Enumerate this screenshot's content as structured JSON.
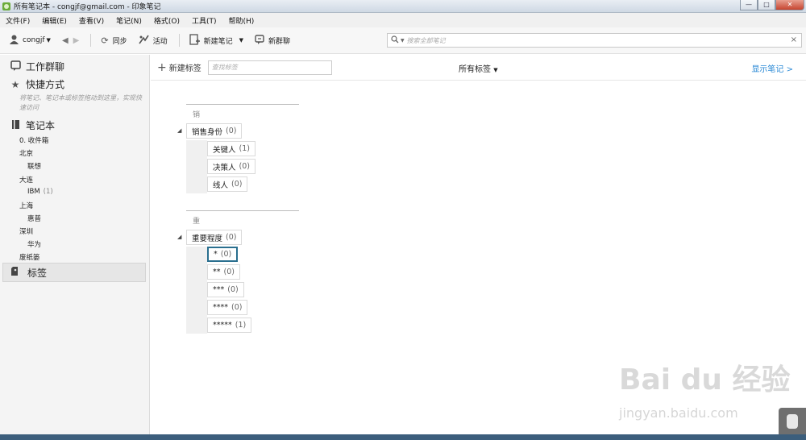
{
  "window": {
    "title": "所有笔记本 - congjf@gmail.com - 印象笔记",
    "minimize": "—",
    "maximize": "□",
    "close": "✕"
  },
  "menu": [
    "文件(F)",
    "编辑(E)",
    "查看(V)",
    "笔记(N)",
    "格式(O)",
    "工具(T)",
    "帮助(H)"
  ],
  "toolbar": {
    "user": "congjf",
    "sync": "同步",
    "activity": "活动",
    "new_note": "新建笔记",
    "new_chat": "新群聊",
    "search_placeholder": "搜索全部笔记",
    "icons": [
      "user-icon",
      "back-arrow-icon",
      "forward-arrow-icon",
      "sync-icon",
      "activity-icon",
      "new-note-icon",
      "chat-icon",
      "search-icon",
      "clear-icon"
    ]
  },
  "sidebar": {
    "work_chat": "工作群聊",
    "shortcuts": "快捷方式",
    "shortcuts_hint": "将笔记、笔记本或标签拖动到这里，实现快速访问",
    "notebooks": "笔记本",
    "notebook_items": [
      {
        "label": "0. 收件箱",
        "count": "",
        "level": 0
      },
      {
        "label": "北京",
        "count": "",
        "level": 0
      },
      {
        "label": "联想",
        "count": "",
        "level": 1
      },
      {
        "label": "大连",
        "count": "",
        "level": 0
      },
      {
        "label": "IBM",
        "count": "(1)",
        "level": 1
      },
      {
        "label": "上海",
        "count": "",
        "level": 0
      },
      {
        "label": "惠普",
        "count": "",
        "level": 1
      },
      {
        "label": "深圳",
        "count": "",
        "level": 0
      },
      {
        "label": "华为",
        "count": "",
        "level": 1
      },
      {
        "label": "废纸篓",
        "count": "",
        "level": 0
      }
    ],
    "tags": "标签"
  },
  "main": {
    "new_tag": "新建标签",
    "tag_search_placeholder": "查找标签",
    "all_tags": "所有标签",
    "show_notes": "显示笔记 >",
    "groups": [
      {
        "letter": "销",
        "parent": {
          "name": "销售身份",
          "count": "(0)"
        },
        "children": [
          {
            "name": "关键人",
            "count": "(1)"
          },
          {
            "name": "决策人",
            "count": "(0)"
          },
          {
            "name": "线人",
            "count": "(0)"
          }
        ]
      },
      {
        "letter": "重",
        "parent": {
          "name": "重要程度",
          "count": "(0)"
        },
        "children": [
          {
            "name": "*",
            "count": "(0)"
          },
          {
            "name": "**",
            "count": "(0)"
          },
          {
            "name": "***",
            "count": "(0)"
          },
          {
            "name": "****",
            "count": "(0)"
          },
          {
            "name": "*****",
            "count": "(1)"
          }
        ]
      }
    ]
  },
  "watermark": {
    "brand": "Bai du 经验",
    "url": "jingyan.baidu.com"
  }
}
